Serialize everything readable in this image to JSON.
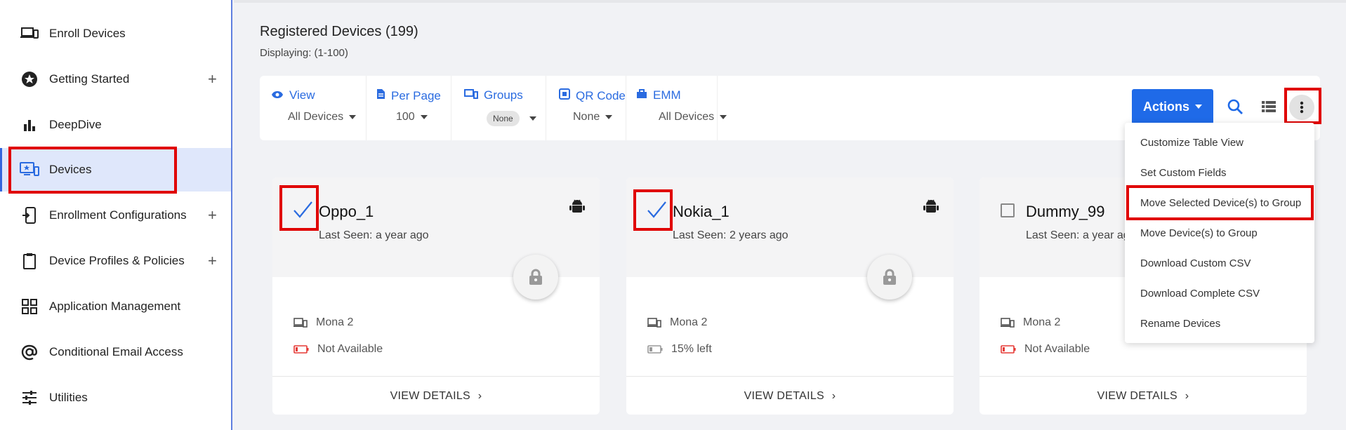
{
  "sidebar": {
    "items": [
      {
        "label": "Enroll Devices",
        "icon": "laptop-phone-icon",
        "expandable": false
      },
      {
        "label": "Getting Started",
        "icon": "star-circle-icon",
        "expandable": true
      },
      {
        "label": "DeepDive",
        "icon": "bar-chart-icon",
        "expandable": false
      },
      {
        "label": "Devices",
        "icon": "devices-icon",
        "expandable": false,
        "active": true
      },
      {
        "label": "Enrollment Configurations",
        "icon": "phone-enroll-icon",
        "expandable": true
      },
      {
        "label": "Device Profiles & Policies",
        "icon": "clipboard-icon",
        "expandable": true
      },
      {
        "label": "Application Management",
        "icon": "grid-icon",
        "expandable": false
      },
      {
        "label": "Conditional Email Access",
        "icon": "at-sign-icon",
        "expandable": false
      },
      {
        "label": "Utilities",
        "icon": "sliders-icon",
        "expandable": false
      }
    ],
    "plus": "+"
  },
  "header": {
    "title": "Registered Devices (199)",
    "subtitle": "Displaying: (1-100)"
  },
  "filters": {
    "view": {
      "label": "View",
      "value": "All Devices",
      "icon": "eye-icon"
    },
    "per_page": {
      "label": "Per Page",
      "value": "100",
      "icon": "document-icon"
    },
    "groups": {
      "label": "Groups",
      "value": "None",
      "icon": "group-icon"
    },
    "qr_code": {
      "label": "QR Code",
      "value": "None",
      "icon": "qr-code-icon"
    },
    "emm": {
      "label": "EMM",
      "value": "All Devices",
      "icon": "briefcase-icon"
    }
  },
  "toolbar": {
    "actions_label": "Actions",
    "search_icon": "search-icon",
    "list_icon": "list-view-icon",
    "more_icon": "more-vertical-icon"
  },
  "dropdown": {
    "items": [
      "Customize Table View",
      "Set Custom Fields",
      "Move Selected Device(s) to Group",
      "Move Device(s) to Group",
      "Download Custom CSV",
      "Download Complete CSV",
      "Rename Devices"
    ]
  },
  "cards": [
    {
      "name": "Oppo_1",
      "last_seen": "Last Seen: a year ago",
      "checked": true,
      "group": "Mona 2",
      "battery": "Not Available",
      "battery_status": "red",
      "view_details": "VIEW DETAILS"
    },
    {
      "name": "Nokia_1",
      "last_seen": "Last Seen: 2 years ago",
      "checked": true,
      "group": "Mona 2",
      "battery": "15% left",
      "battery_status": "gray",
      "view_details": "VIEW DETAILS"
    },
    {
      "name": "Dummy_99",
      "last_seen": "Last Seen: a year ago",
      "checked": false,
      "group": "Mona 2",
      "battery": "Not Available",
      "battery_status": "red",
      "view_details": "VIEW DETAILS"
    }
  ],
  "colors": {
    "accent": "#1f6ae8",
    "highlight_box": "#e00000",
    "active_nav_bg": "#dfe7fb"
  }
}
